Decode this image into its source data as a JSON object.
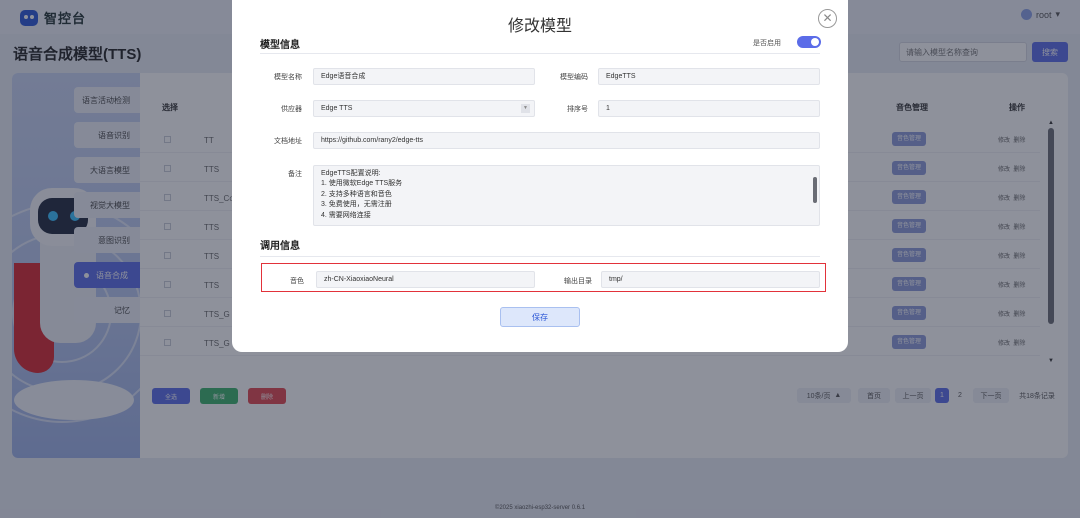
{
  "app": {
    "logo_text": "智控台",
    "user": "root"
  },
  "page": {
    "title": "语音合成模型(TTS)",
    "search_placeholder": "请输入模型名称查询",
    "search_button": "搜索"
  },
  "nav": {
    "items": [
      "语言活动检测",
      "语音识别",
      "大语言模型",
      "视觉大模型",
      "意图识别",
      "语音合成",
      "记忆"
    ],
    "active": "语音合成"
  },
  "table": {
    "headers": {
      "select": "选择",
      "voice_mgmt": "音色管理",
      "actions": "操作"
    },
    "row_names": [
      "TT",
      "TTS",
      "TTS_Co",
      "TTS",
      "TTS",
      "TTS",
      "TTS_G",
      "TTS_G"
    ],
    "voice_button": "音色管理",
    "edit": "修改",
    "delete": "删除"
  },
  "bottom_bar": {
    "select_all": "全选",
    "add": "新增",
    "delete": "删除",
    "page_size": "10条/页",
    "first": "首页",
    "prev": "上一页",
    "pages": [
      "1",
      "2"
    ],
    "next": "下一页",
    "total": "共18条记录"
  },
  "footer": "©2025 xiaozhi-esp32-server 0.6.1",
  "modal": {
    "title": "修改模型",
    "model_info_title": "模型信息",
    "enable_label": "是否启用",
    "enabled": true,
    "fields": {
      "name_label": "模型名称",
      "name": "Edge语音合成",
      "code_label": "模型编码",
      "code": "EdgeTTS",
      "provider_label": "供应器",
      "provider": "Edge TTS",
      "sort_label": "排序号",
      "sort": "1",
      "doc_label": "文档地址",
      "doc": "https://github.com/rany2/edge-tts",
      "remark_label": "备注",
      "remark_lines": [
        "EdgeTTS配置说明:",
        "1. 使用微软Edge TTS服务",
        "2. 支持多种语言和音色",
        "3. 免费使用，无需注册",
        "4. 需要网络连接"
      ]
    },
    "call_info_title": "调用信息",
    "call": {
      "voice_label": "音色",
      "voice": "zh-CN-XiaoxiaoNeural",
      "output_label": "输出目录",
      "output": "tmp/"
    },
    "save": "保存"
  }
}
